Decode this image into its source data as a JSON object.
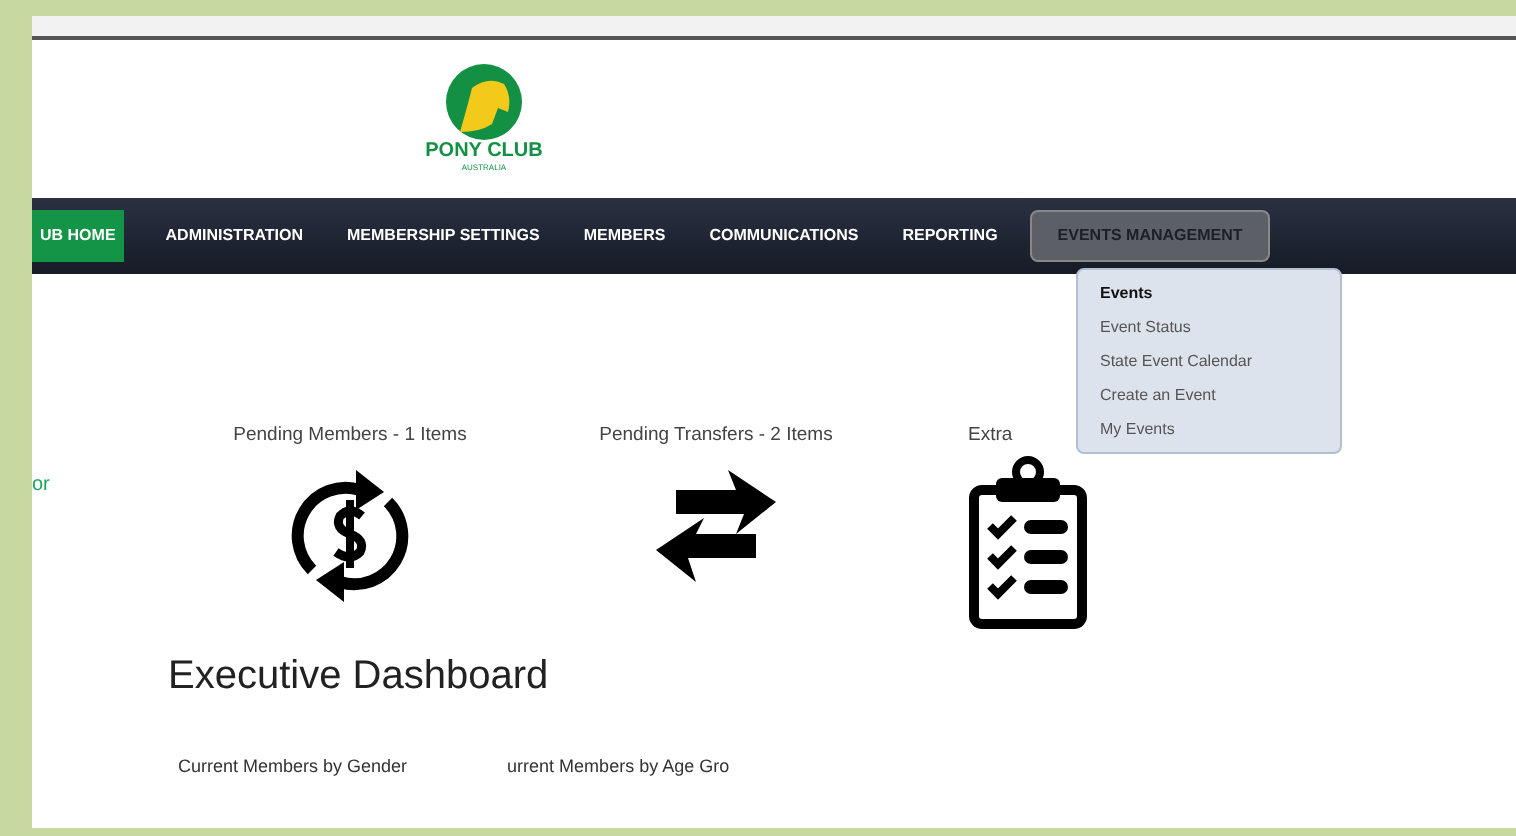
{
  "logo": {
    "name": "PONY CLUB",
    "subtitle": "AUSTRALIA"
  },
  "nav": [
    {
      "label": "UB HOME",
      "kind": "home",
      "selected": false
    },
    {
      "label": "ADMINISTRATION",
      "kind": "item",
      "selected": false
    },
    {
      "label": "MEMBERSHIP SETTINGS",
      "kind": "item",
      "selected": false
    },
    {
      "label": "MEMBERS",
      "kind": "item",
      "selected": false
    },
    {
      "label": "COMMUNICATIONS",
      "kind": "item",
      "selected": false
    },
    {
      "label": "REPORTING",
      "kind": "item",
      "selected": false
    },
    {
      "label": "EVENTS MANAGEMENT",
      "kind": "item",
      "selected": true
    }
  ],
  "dropdown": [
    {
      "label": "Events",
      "selected": true
    },
    {
      "label": "Event Status",
      "selected": false
    },
    {
      "label": "State Event Calendar",
      "selected": false
    },
    {
      "label": "Create an Event",
      "selected": false
    },
    {
      "label": "My Events",
      "selected": false
    }
  ],
  "side_text": "or",
  "cards": [
    {
      "label": "Pending Members - 1 Items",
      "kind": "dollar"
    },
    {
      "label": "Pending Transfers - 2 Items",
      "kind": "transfer"
    },
    {
      "label": "Extra",
      "kind": "clipboard"
    }
  ],
  "heading": "Executive Dashboard",
  "subheadings": [
    "Current Members by Gender",
    "urrent Members by Age Gro"
  ]
}
